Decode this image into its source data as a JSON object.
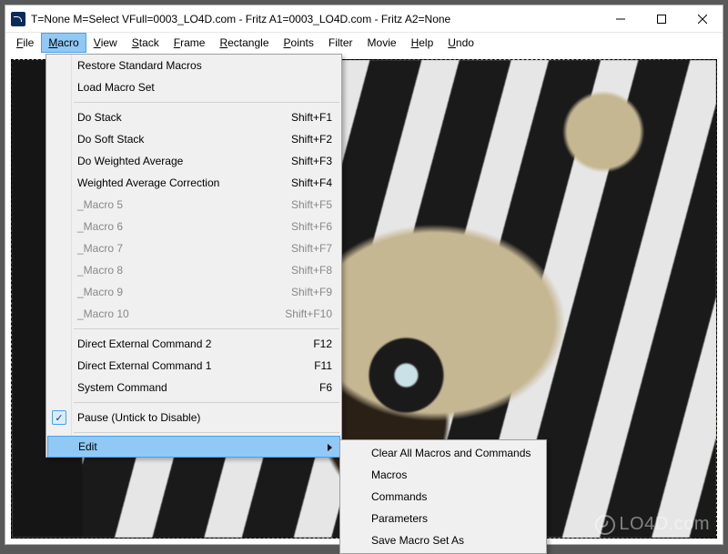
{
  "window": {
    "title": "T=None M=Select VFull=0003_LO4D.com - Fritz A1=0003_LO4D.com - Fritz A2=None"
  },
  "menubar": {
    "items": [
      {
        "label": "File",
        "underline": "F"
      },
      {
        "label": "Macro",
        "underline": "M",
        "open": true
      },
      {
        "label": "View",
        "underline": "V"
      },
      {
        "label": "Stack",
        "underline": "S"
      },
      {
        "label": "Frame",
        "underline": "F"
      },
      {
        "label": "Rectangle",
        "underline": "R"
      },
      {
        "label": "Points",
        "underline": "P"
      },
      {
        "label": "Filter",
        "underline": "Filter"
      },
      {
        "label": "Movie",
        "underline": ""
      },
      {
        "label": "Help",
        "underline": "H"
      },
      {
        "label": "Undo",
        "underline": "U"
      }
    ]
  },
  "dropdown": {
    "groups": [
      [
        {
          "label": "Restore Standard Macros",
          "shortcut": "",
          "disabled": false
        },
        {
          "label": "Load Macro Set",
          "shortcut": "",
          "disabled": false
        }
      ],
      [
        {
          "label": "Do Stack",
          "shortcut": "Shift+F1",
          "disabled": false
        },
        {
          "label": "Do Soft Stack",
          "shortcut": "Shift+F2",
          "disabled": false
        },
        {
          "label": "Do Weighted Average",
          "shortcut": "Shift+F3",
          "disabled": false
        },
        {
          "label": "Weighted Average Correction",
          "shortcut": "Shift+F4",
          "disabled": false
        },
        {
          "label": "_Macro 5",
          "shortcut": "Shift+F5",
          "disabled": true
        },
        {
          "label": "_Macro 6",
          "shortcut": "Shift+F6",
          "disabled": true
        },
        {
          "label": "_Macro 7",
          "shortcut": "Shift+F7",
          "disabled": true
        },
        {
          "label": "_Macro 8",
          "shortcut": "Shift+F8",
          "disabled": true
        },
        {
          "label": "_Macro 9",
          "shortcut": "Shift+F9",
          "disabled": true
        },
        {
          "label": "_Macro 10",
          "shortcut": "Shift+F10",
          "disabled": true
        }
      ],
      [
        {
          "label": "Direct External Command 2",
          "shortcut": "F12",
          "disabled": false
        },
        {
          "label": "Direct External Command 1",
          "shortcut": "F11",
          "disabled": false
        },
        {
          "label": "System Command",
          "shortcut": "F6",
          "disabled": false
        }
      ],
      [
        {
          "label": "Pause (Untick to Disable)",
          "shortcut": "",
          "disabled": false,
          "checked": true
        }
      ],
      [
        {
          "label": "Edit",
          "shortcut": "",
          "disabled": false,
          "submenu": true,
          "highlight": true
        }
      ]
    ]
  },
  "submenu": {
    "items": [
      {
        "label": "Clear All Macros and Commands"
      },
      {
        "label": "Macros"
      },
      {
        "label": "Commands"
      },
      {
        "label": "Parameters"
      },
      {
        "label": "Save Macro Set As"
      }
    ]
  },
  "watermark": {
    "text": "LO4D.com"
  }
}
